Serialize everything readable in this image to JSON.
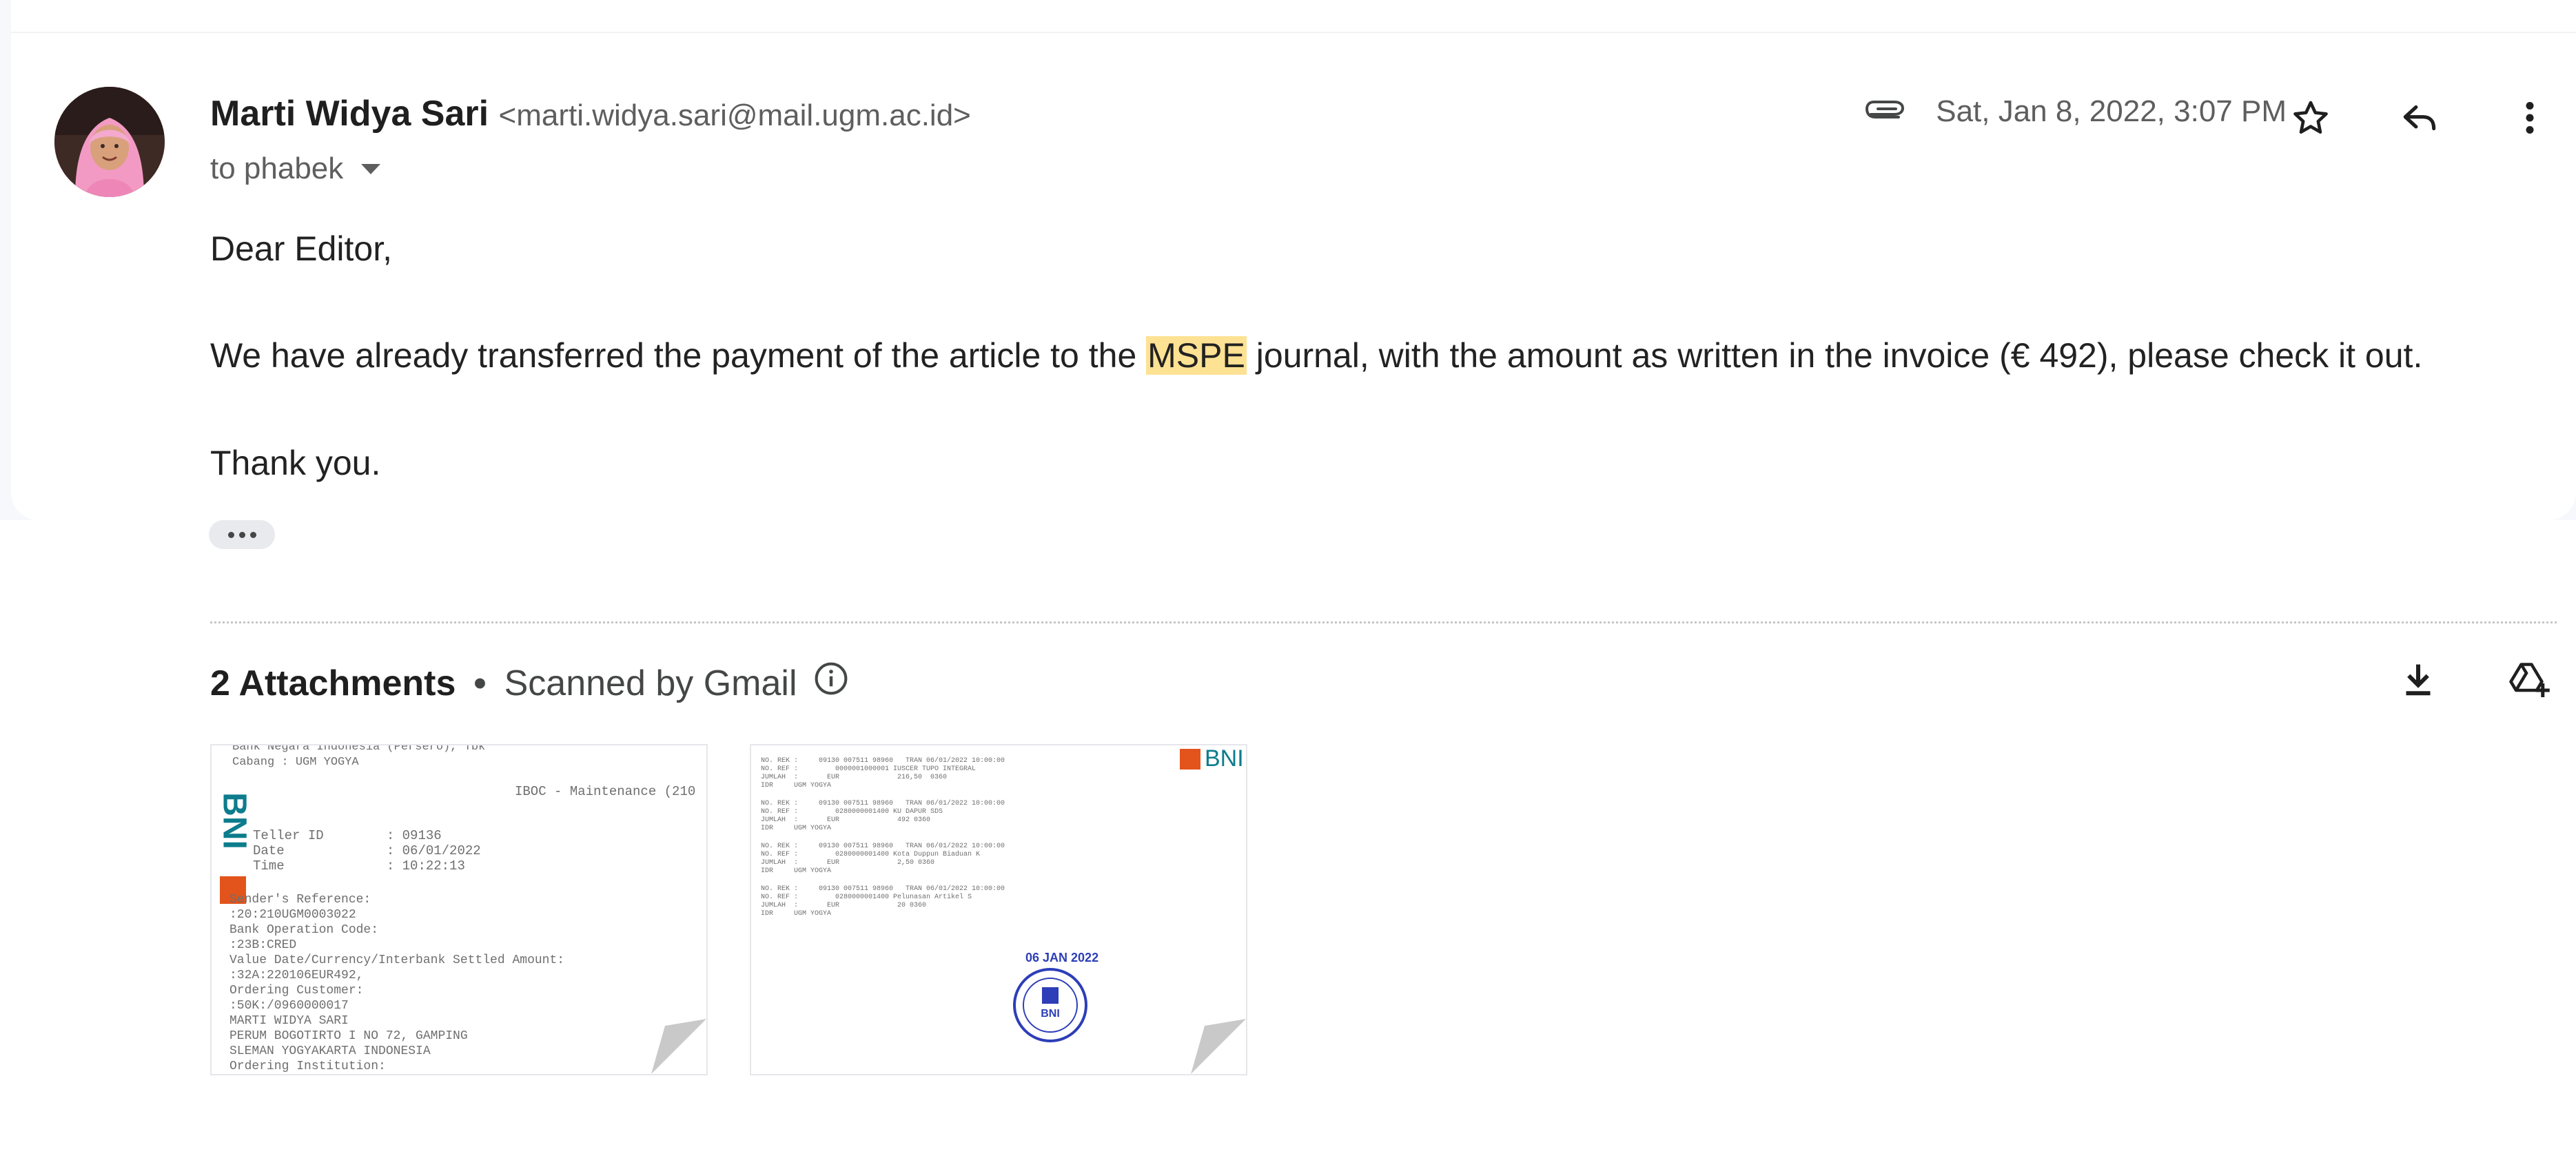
{
  "email": {
    "sender_name": "Marti Widya Sari",
    "sender_email": "<marti.widya.sari@mail.ugm.ac.id>",
    "recipient": "to phabek",
    "date": "Sat, Jan 8, 2022, 3:07 PM",
    "body": {
      "greeting": "Dear Editor,",
      "p1_before": "We have already transferred the payment of the article to the ",
      "p1_highlight": "MSPE",
      "p1_after": " journal, with the amount as written in the invoice (€ 492), please check it out.",
      "closing": "Thank you."
    }
  },
  "attachments": {
    "title": "2 Attachments",
    "separator": "•",
    "scan_note": "Scanned by Gmail",
    "items": [
      {
        "logo": "BNI",
        "text_lines": [
          "Bank Negara Indonesia (Persero), Tbk",
          "Cabang : UGM YOGYA",
          "IBOC - Maintenance (210",
          "Teller ID        : 09136",
          "Date             : 06/01/2022",
          "Time             : 10:22:13",
          "Sender's Reference:",
          ":20:210UGM0003022",
          "Bank Operation Code:",
          ":23B:CRED",
          "Value Date/Currency/Interbank Settled Amount:",
          ":32A:220106EUR492,",
          "Ordering Customer:",
          ":50K:/0960000017",
          "MARTI WIDYA SARI",
          "PERUM BOGOTIRTO I NO 72, GAMPING",
          "SLEMAN YOGYAKARTA INDONESIA",
          "Ordering Institution:"
        ]
      },
      {
        "logo": "BNI",
        "stamp_date": "06 JAN 2022",
        "stamp_text": "BNI",
        "text_lines": [
          "NO. REK :     09130 007511 98960   TRAN 06/01/2022 10:00:00",
          "NO. REF :         0000001000001 IUSCER TUPO INTEGRAL",
          "JUMLAH  :       EUR              216,50  0360",
          "IDR     UGM YOGYA",
          "NO. REK :     09130 007511 98960   TRAN 06/01/2022 10:00:00",
          "NO. REF :         0280000001400 KU DAPUR SDS",
          "JUMLAH  :       EUR              492 0360",
          "IDR     UGM YOGYA",
          "NO. REK :     09130 007511 98960   TRAN 06/01/2022 10:00:00",
          "NO. REF :         0280000001400 Kota Duppun Biaduan K",
          "JUMLAH  :       EUR              2,50 0360",
          "IDR     UGM YOGYA",
          "NO. REK :     09130 007511 98960   TRAN 06/01/2022 10:00:00",
          "NO. REF :         0280000001400 Pelunasan Artikel S",
          "JUMLAH  :       EUR              20 0360",
          "IDR     UGM YOGYA"
        ]
      }
    ]
  },
  "colors": {
    "highlight": "#fde293",
    "bni_orange": "#e2541b",
    "bni_teal": "#0d7c8c",
    "stamp_blue": "#2d3eb8"
  }
}
